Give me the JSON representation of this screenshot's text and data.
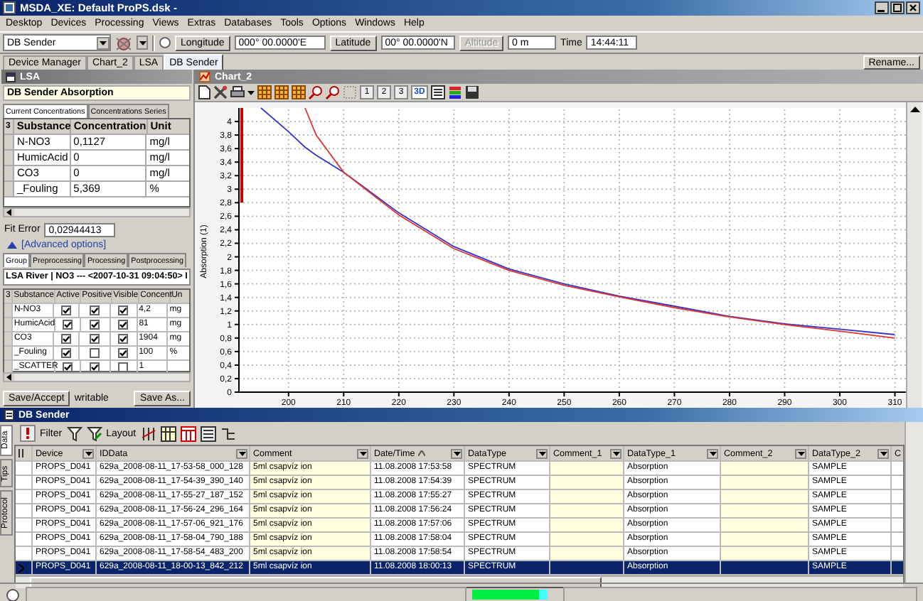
{
  "window": {
    "title": "MSDA_XE: Default ProPS.dsk -"
  },
  "menu": [
    "Desktop",
    "Devices",
    "Processing",
    "Views",
    "Extras",
    "Databases",
    "Tools",
    "Options",
    "Windows",
    "Help"
  ],
  "toolbar": {
    "device": "DB Sender",
    "gps": {
      "checked": false
    },
    "longitude_button": "Longitude",
    "longitude": "000° 00.0000'E",
    "latitude_button": "Latitude",
    "latitude": "00° 00.0000'N",
    "altitude_button": {
      "label": "Altitude",
      "disabled": true
    },
    "altitude": "0 m",
    "time_label": "Time",
    "time": "14:44:11"
  },
  "tabs": [
    {
      "label": "Device Manager",
      "selected": false
    },
    {
      "label": "Chart_2",
      "selected": false
    },
    {
      "label": "LSA",
      "selected": false
    },
    {
      "label": "DB Sender",
      "selected": true
    }
  ],
  "rename_button": "Rename...",
  "lsa": {
    "title": "LSA",
    "header": "DB Sender Absorption",
    "tabs": [
      {
        "label": "Current Concentrations",
        "selected": true
      },
      {
        "label": "Concentrations Series",
        "selected": false
      }
    ],
    "columns": [
      "3",
      "Substance",
      "Concentration",
      "Unit"
    ],
    "rows": [
      [
        "",
        "N-NO3",
        "0,1127",
        "mg/l"
      ],
      [
        "",
        "HumicAcid",
        "0",
        "mg/l"
      ],
      [
        "",
        "CO3",
        "0",
        "mg/l"
      ],
      [
        "",
        "_Fouling",
        "5,369",
        "%"
      ]
    ],
    "fit_error_label": "Fit Error",
    "fit_error": "0,02944413",
    "advanced": {
      "label": "[Advanced options]",
      "expanded": true
    },
    "group_tabs": [
      {
        "label": "Group",
        "selected": true
      },
      {
        "label": "Preprocessing",
        "selected": false
      },
      {
        "label": "Processing",
        "selected": false
      },
      {
        "label": "Postprocessing",
        "selected": false
      }
    ],
    "group": "LSA River | NO3 --- <2007-10-31 09:04:50> I",
    "sub_columns": [
      "3",
      "Substance",
      "Active",
      "Positive",
      "Visible",
      "Concent",
      "Un"
    ],
    "substances": [
      {
        "name": "N-NO3",
        "active": true,
        "positive": true,
        "visible": true,
        "concentration": "4,2",
        "unit": "mg"
      },
      {
        "name": "HumicAcid",
        "active": true,
        "positive": true,
        "visible": true,
        "concentration": "81",
        "unit": "mg"
      },
      {
        "name": "CO3",
        "active": true,
        "positive": true,
        "visible": true,
        "concentration": "1904",
        "unit": "mg"
      },
      {
        "name": "_Fouling",
        "active": true,
        "positive": false,
        "visible": true,
        "concentration": "100",
        "unit": "%"
      },
      {
        "name": "_SCATTER",
        "active": true,
        "positive": true,
        "visible": false,
        "concentration": "1"
      }
    ],
    "save_button": "Save/Accept",
    "mode": "writable",
    "save_as_button": "Save As..."
  },
  "chart": {
    "title": "Chart_2",
    "toolbar_buttons": [
      "1",
      "2",
      "3",
      "3D"
    ],
    "chart_data": {
      "type": "line",
      "ylabel": "Absorption (1)",
      "xlim": [
        191,
        312
      ],
      "ylim": [
        0,
        4.2
      ],
      "x": [
        195,
        200,
        203,
        205,
        210,
        220,
        230,
        240,
        250,
        260,
        270,
        280,
        290,
        300,
        310
      ],
      "grid": true,
      "series": [
        {
          "color": "#3333cc",
          "values": [
            4.2,
            3.85,
            3.62,
            3.5,
            3.25,
            2.65,
            2.15,
            1.82,
            1.6,
            1.42,
            1.27,
            1.12,
            1.01,
            0.93,
            0.85
          ]
        },
        {
          "color": "#dd3333",
          "values": [
            null,
            null,
            4.2,
            3.8,
            3.25,
            2.62,
            2.12,
            1.8,
            1.58,
            1.41,
            1.25,
            1.11,
            1.0,
            0.9,
            0.8
          ]
        }
      ],
      "xticks": [
        200,
        210,
        220,
        230,
        240,
        250,
        260,
        270,
        280,
        290,
        300,
        310
      ],
      "yticks": [
        0,
        {
          "value": 0.2,
          "label": "0,2"
        },
        {
          "value": 0.4,
          "label": "0,4"
        },
        {
          "value": 0.6,
          "label": "0,6"
        },
        {
          "value": 0.8,
          "label": "0,8"
        },
        1,
        {
          "value": 1.2,
          "label": "1,2"
        },
        {
          "value": 1.4,
          "label": "1,4"
        },
        {
          "value": 1.6,
          "label": "1,6"
        },
        {
          "value": 1.8,
          "label": "1,8"
        },
        2,
        {
          "value": 2.2,
          "label": "2,2"
        },
        {
          "value": 2.4,
          "label": "2,4"
        },
        {
          "value": 2.6,
          "label": "2,6"
        },
        {
          "value": 2.8,
          "label": "2,8"
        },
        3,
        {
          "value": 3.2,
          "label": "3,2"
        },
        {
          "value": 3.4,
          "label": "3,4"
        },
        {
          "value": 3.6,
          "label": "3,6"
        },
        {
          "value": 3.8,
          "label": "3,8"
        },
        4
      ]
    }
  },
  "db_sender": {
    "title": "DB Sender",
    "filter_label": "Filter",
    "layout_label": "Layout",
    "side_tabs": [
      {
        "label": "Data",
        "selected": true
      },
      {
        "label": "Tips",
        "selected": false
      },
      {
        "label": "Protocol",
        "selected": false
      }
    ],
    "columns": [
      "Device",
      "IDData",
      "Comment",
      "Date/Time",
      "DataType",
      "Comment_1",
      "DataType_1",
      "Comment_2",
      "DataType_2",
      "C"
    ],
    "rows": [
      {
        "selected": false,
        "cells": [
          "PROPS_D041",
          "629a_2008-08-11_17-53-58_000_128",
          "5ml csapvíz ion",
          "11.08.2008 17:53:58",
          "SPECTRUM",
          "",
          "Absorption",
          "",
          "SAMPLE"
        ]
      },
      {
        "selected": false,
        "cells": [
          "PROPS_D041",
          "629a_2008-08-11_17-54-39_390_140",
          "5ml csapvíz ion",
          "11.08.2008 17:54:39",
          "SPECTRUM",
          "",
          "Absorption",
          "",
          "SAMPLE"
        ]
      },
      {
        "selected": false,
        "cells": [
          "PROPS_D041",
          "629a_2008-08-11_17-55-27_187_152",
          "5ml csapvíz ion",
          "11.08.2008 17:55:27",
          "SPECTRUM",
          "",
          "Absorption",
          "",
          "SAMPLE"
        ]
      },
      {
        "selected": false,
        "cells": [
          "PROPS_D041",
          "629a_2008-08-11_17-56-24_296_164",
          "5ml csapvíz ion",
          "11.08.2008 17:56:24",
          "SPECTRUM",
          "",
          "Absorption",
          "",
          "SAMPLE"
        ]
      },
      {
        "selected": false,
        "cells": [
          "PROPS_D041",
          "629a_2008-08-11_17-57-06_921_176",
          "5ml csapvíz ion",
          "11.08.2008 17:57:06",
          "SPECTRUM",
          "",
          "Absorption",
          "",
          "SAMPLE"
        ]
      },
      {
        "selected": false,
        "cells": [
          "PROPS_D041",
          "629a_2008-08-11_17-58-04_790_188",
          "5ml csapvíz ion",
          "11.08.2008 17:58:04",
          "SPECTRUM",
          "",
          "Absorption",
          "",
          "SAMPLE"
        ]
      },
      {
        "selected": false,
        "cells": [
          "PROPS_D041",
          "629a_2008-08-11_17-58-54_483_200",
          "5ml csapvíz ion",
          "11.08.2008 17:58:54",
          "SPECTRUM",
          "",
          "Absorption",
          "",
          "SAMPLE"
        ]
      },
      {
        "selected": true,
        "cells": [
          "PROPS_D041",
          "629a_2008-08-11_18-00-13_842_212",
          "5ml csapvíz ion",
          "11.08.2008 18:00:13",
          "SPECTRUM",
          "",
          "Absorption",
          "",
          "SAMPLE"
        ]
      }
    ]
  },
  "status_bar": {
    "level": 0.88
  }
}
